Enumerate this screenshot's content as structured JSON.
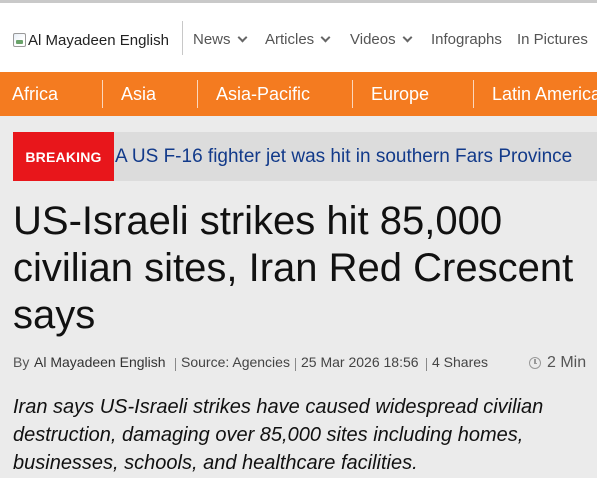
{
  "header": {
    "logo_alt": "Al Mayadeen English",
    "nav": [
      {
        "label": "News",
        "has_dropdown": true
      },
      {
        "label": "Articles",
        "has_dropdown": true
      },
      {
        "label": "Videos",
        "has_dropdown": true
      },
      {
        "label": "Infographs",
        "has_dropdown": false
      },
      {
        "label": "In Pictures",
        "has_dropdown": false
      }
    ]
  },
  "regions": [
    "Africa",
    "Asia",
    "Asia-Pacific",
    "Europe",
    "Latin America"
  ],
  "breaking": {
    "badge": "BREAKING",
    "text": "A US F-16 fighter jet was hit in southern Fars Province"
  },
  "article": {
    "headline": "US-Israeli strikes hit 85,000 civilian sites, Iran Red Crescent says",
    "meta": {
      "by": "By",
      "author": "Al Mayadeen English",
      "source": "Source: Agencies",
      "date": "25 Mar 2026 18:56",
      "shares": "4 Shares",
      "read_time": "2 Min"
    },
    "summary": "Iran says US-Israeli strikes have caused widespread civilian destruction, damaging over 85,000 sites including homes, businesses, schools, and healthcare facilities."
  },
  "colors": {
    "region_bar": "#f47b20",
    "breaking_badge": "#e8161b",
    "breaking_text": "#123a8a",
    "page_bg": "#ebebeb"
  }
}
